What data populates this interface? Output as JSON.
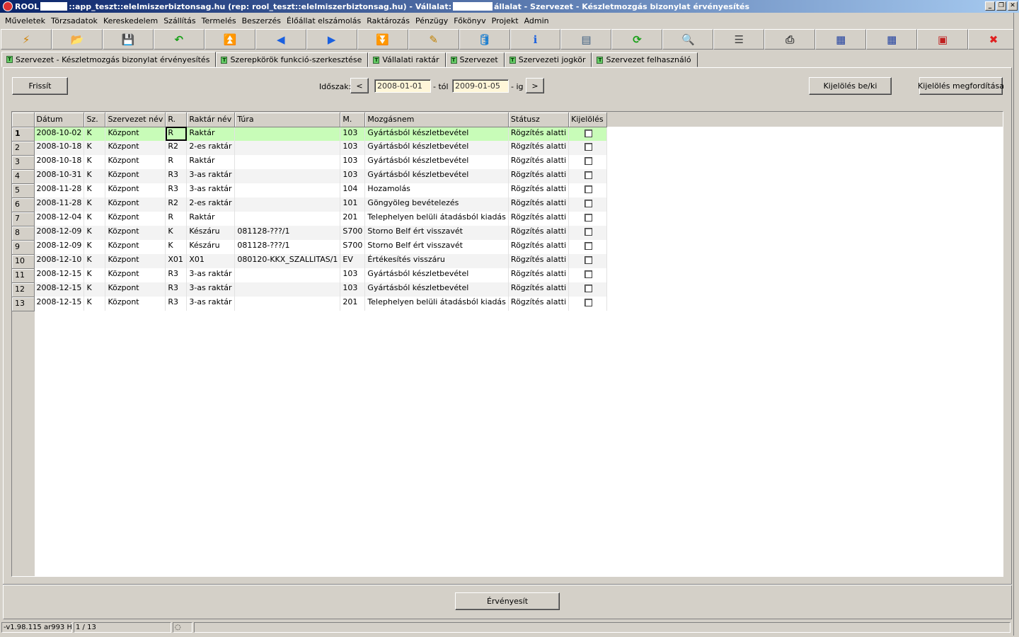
{
  "window": {
    "title_app": "ROOL",
    "title_mid": "::app_teszt::elelmiszerbiztonsag.hu (rep: rool_teszt::elelmiszerbiztonsag.hu) - Vállalat:",
    "title_end": "állalat - Szervezet - Készletmozgás bizonylat érvényesítés",
    "btn_minimize": "_",
    "btn_restore": "❐",
    "btn_close": "✕"
  },
  "menu": [
    "Műveletek",
    "Törzsadatok",
    "Kereskedelem",
    "Szállítás",
    "Termelés",
    "Beszerzés",
    "Élőállat elszámolás",
    "Raktározás",
    "Pénzügy",
    "Főkönyv",
    "Projekt",
    "Admin"
  ],
  "toolbar": [
    {
      "name": "lightning-icon",
      "glyph": "⚡",
      "color": "#d08000"
    },
    {
      "name": "open-folder-icon",
      "glyph": "📂",
      "color": "#2060c0"
    },
    {
      "name": "save-icon",
      "glyph": "💾",
      "color": "#203080"
    },
    {
      "name": "undo-arrow-icon",
      "glyph": "↶",
      "color": "#18a018"
    },
    {
      "name": "first-record-icon",
      "glyph": "⏫",
      "color": "#1a60e0"
    },
    {
      "name": "previous-record-icon",
      "glyph": "◀",
      "color": "#1a60e0"
    },
    {
      "name": "next-record-icon",
      "glyph": "▶",
      "color": "#1a60e0"
    },
    {
      "name": "last-record-icon",
      "glyph": "⏬",
      "color": "#1a60e0"
    },
    {
      "name": "edit-icon",
      "glyph": "✎",
      "color": "#c08000"
    },
    {
      "name": "database-icon",
      "glyph": "🛢",
      "color": "#2080d0"
    },
    {
      "name": "info-icon",
      "glyph": "ℹ",
      "color": "#1a60e0"
    },
    {
      "name": "window-icon",
      "glyph": "▤",
      "color": "#406080"
    },
    {
      "name": "refresh-icon",
      "glyph": "⟳",
      "color": "#18a018"
    },
    {
      "name": "search-icon",
      "glyph": "🔍",
      "color": "#806020"
    },
    {
      "name": "rows-icon",
      "glyph": "☰",
      "color": "#404040"
    },
    {
      "name": "print-icon",
      "glyph": "⎙",
      "color": "#404040"
    },
    {
      "name": "grid-export-icon",
      "glyph": "▦",
      "color": "#2040a0"
    },
    {
      "name": "grid-import-icon",
      "glyph": "▦",
      "color": "#2040a0"
    },
    {
      "name": "fullscreen-icon",
      "glyph": "▣",
      "color": "#c02020"
    },
    {
      "name": "close-icon",
      "glyph": "✖",
      "color": "#e02020"
    }
  ],
  "tabs": [
    {
      "label": "Szervezet - Készletmozgás bizonylat érvényesítés",
      "active": true
    },
    {
      "label": "Szerepkörök funkció-szerkesztése",
      "active": false
    },
    {
      "label": "Vállalati raktár",
      "active": false
    },
    {
      "label": "Szervezet",
      "active": false
    },
    {
      "label": "Szervezeti jogkör",
      "active": false
    },
    {
      "label": "Szervezet felhasználó",
      "active": false
    }
  ],
  "filter": {
    "refresh_label": "Frissít",
    "period_label": "Időszak:",
    "prev_label": "<",
    "next_label": ">",
    "date_from": "2008-01-01",
    "from_suffix": "- tól",
    "date_to": "2009-01-05",
    "to_suffix": "- ig",
    "toggle_select_label": "Kijelölés be/ki",
    "invert_select_label": "Kijelölés megfordítása"
  },
  "grid": {
    "columns": [
      "Dátum",
      "Sz.",
      "Szervezet név",
      "R.",
      "Raktár név",
      "Túra",
      "M.",
      "Mozgásnem",
      "Státusz",
      "Kijelölés"
    ],
    "rows": [
      [
        "2008-10-02",
        "K",
        "Központ",
        "R",
        "Raktár",
        "",
        "103",
        "Gyártásból készletbevétel",
        "Rögzítés alatti"
      ],
      [
        "2008-10-18",
        "K",
        "Központ",
        "R2",
        "2-es raktár",
        "",
        "103",
        "Gyártásból készletbevétel",
        "Rögzítés alatti"
      ],
      [
        "2008-10-18",
        "K",
        "Központ",
        "R",
        "Raktár",
        "",
        "103",
        "Gyártásból készletbevétel",
        "Rögzítés alatti"
      ],
      [
        "2008-10-31",
        "K",
        "Központ",
        "R3",
        "3-as raktár",
        "",
        "103",
        "Gyártásból készletbevétel",
        "Rögzítés alatti"
      ],
      [
        "2008-11-28",
        "K",
        "Központ",
        "R3",
        "3-as raktár",
        "",
        "104",
        "Hozamolás",
        "Rögzítés alatti"
      ],
      [
        "2008-11-28",
        "K",
        "Központ",
        "R2",
        "2-es raktár",
        "",
        "101",
        "Göngyöleg bevételezés",
        "Rögzítés alatti"
      ],
      [
        "2008-12-04",
        "K",
        "Központ",
        "R",
        "Raktár",
        "",
        "201",
        "Telephelyen belüli átadásból kiadás",
        "Rögzítés alatti"
      ],
      [
        "2008-12-09",
        "K",
        "Központ",
        "K",
        "Készáru",
        "081128-???/1",
        "S700",
        "Storno Belf ért visszavét",
        "Rögzítés alatti"
      ],
      [
        "2008-12-09",
        "K",
        "Központ",
        "K",
        "Készáru",
        "081128-???/1",
        "S700",
        "Storno Belf ért visszavét",
        "Rögzítés alatti"
      ],
      [
        "2008-12-10",
        "K",
        "Központ",
        "X01",
        "X01",
        "080120-KKX_SZALLITAS/1",
        "EV",
        "Értékesítés visszáru",
        "Rögzítés alatti"
      ],
      [
        "2008-12-15",
        "K",
        "Központ",
        "R3",
        "3-as raktár",
        "",
        "103",
        "Gyártásból készletbevétel",
        "Rögzítés alatti"
      ],
      [
        "2008-12-15",
        "K",
        "Központ",
        "R3",
        "3-as raktár",
        "",
        "103",
        "Gyártásból készletbevétel",
        "Rögzítés alatti"
      ],
      [
        "2008-12-15",
        "K",
        "Központ",
        "R3",
        "3-as raktár",
        "",
        "201",
        "Telephelyen belüli átadásból kiadás",
        "Rögzítés alatti"
      ]
    ],
    "selected_row": 0
  },
  "actions": {
    "validate_label": "Érvényesít"
  },
  "status": {
    "version": "-v1.98.115 ar993 H",
    "record": "1 / 13"
  }
}
